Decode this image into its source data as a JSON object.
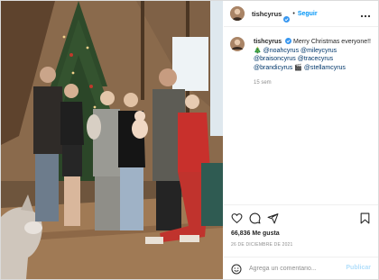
{
  "post": {
    "username": "tishcyrus",
    "follow_label": "Seguir",
    "more_icon": "more-options-icon",
    "verified_icon": "verified-badge-icon"
  },
  "caption": {
    "username": "tishcyrus",
    "text_before": "Merry Christmas everyone!!",
    "tags_line1": "@noahcyrus @mileycyrus",
    "tags_line2": "@braisoncyrus @tracecyrus",
    "tags_line3": "@brandicyrus",
    "tags_line3b": "@stellamcyrus",
    "tree_emoji": "🎄",
    "clapper_emoji": "🎬",
    "time_ago": "15 sem"
  },
  "actions": {
    "like_icon": "heart-icon",
    "comment_icon": "comment-icon",
    "share_icon": "share-icon",
    "save_icon": "bookmark-icon"
  },
  "likes": "66,836 Me gusta",
  "date": "26 DE DICIEMBRE DE 2021",
  "comment": {
    "placeholder": "Agrega un comentario...",
    "publish_label": "Publicar",
    "emoji_icon": "emoji-icon"
  },
  "colors": {
    "accent": "#0095f6",
    "publish_disabled": "#b2dffc",
    "mention": "#00376b",
    "muted": "#8e8e8e"
  }
}
